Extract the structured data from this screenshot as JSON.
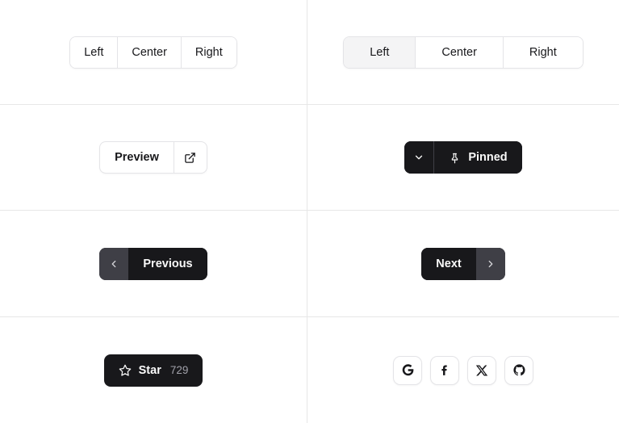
{
  "cells": {
    "segmented_plain": {
      "name": "segmented-control-plain",
      "options": [
        {
          "label": "Left",
          "active": false
        },
        {
          "label": "Center",
          "active": false
        },
        {
          "label": "Right",
          "active": false
        }
      ]
    },
    "segmented_selected": {
      "name": "segmented-control-selected",
      "options": [
        {
          "label": "Left",
          "active": true
        },
        {
          "label": "Center",
          "active": false
        },
        {
          "label": "Right",
          "active": false
        }
      ]
    },
    "preview": {
      "label": "Preview",
      "icon": "external-link-icon"
    },
    "pinned": {
      "label": "Pinned",
      "icon": "pin-icon",
      "aux_icon": "chevron-down-icon"
    },
    "previous": {
      "label": "Previous",
      "aux_icon": "chevron-left-icon"
    },
    "next": {
      "label": "Next",
      "aux_icon": "chevron-right-icon"
    },
    "star": {
      "label": "Star",
      "count": "729",
      "icon": "star-icon"
    },
    "social": {
      "buttons": [
        {
          "name": "google-icon",
          "label": "Google"
        },
        {
          "name": "facebook-icon",
          "label": "Facebook"
        },
        {
          "name": "x-icon",
          "label": "X"
        },
        {
          "name": "github-icon",
          "label": "GitHub"
        }
      ]
    }
  },
  "colors": {
    "dark": "#18181b",
    "dark_aux": "#3f3f46",
    "border": "#e4e4e7",
    "divider": "#e7e7e7",
    "active_bg": "#f4f4f5",
    "muted_text": "#a1a1aa"
  }
}
